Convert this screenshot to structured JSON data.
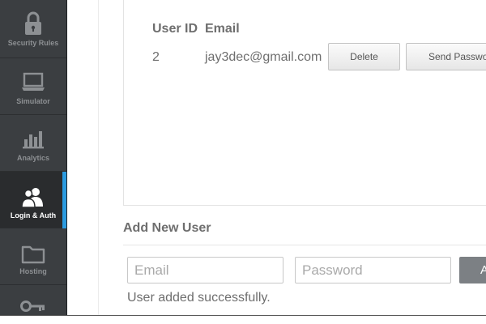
{
  "sidebar": {
    "items": [
      {
        "label": "Security Rules",
        "icon": "lock-icon"
      },
      {
        "label": "Simulator",
        "icon": "laptop-icon"
      },
      {
        "label": "Analytics",
        "icon": "bar-chart-icon"
      },
      {
        "label": "Login & Auth",
        "icon": "users-icon",
        "active": true
      },
      {
        "label": "Hosting",
        "icon": "folder-icon"
      },
      {
        "label": "",
        "icon": "key-icon"
      }
    ]
  },
  "users_table": {
    "columns": [
      "User ID",
      "Email"
    ],
    "rows": [
      {
        "id": "2",
        "email": "jay3dec@gmail.com",
        "delete_label": "Delete",
        "reset_label": "Send Password Reset"
      }
    ]
  },
  "add_user": {
    "title": "Add New User",
    "email_placeholder": "Email",
    "password_placeholder": "Password",
    "add_label": "Add",
    "status": "User added successfully."
  },
  "colors": {
    "sidebar_bg": "#3b3e41",
    "active_accent": "#2b9be0",
    "text": "#6e6e6e"
  }
}
